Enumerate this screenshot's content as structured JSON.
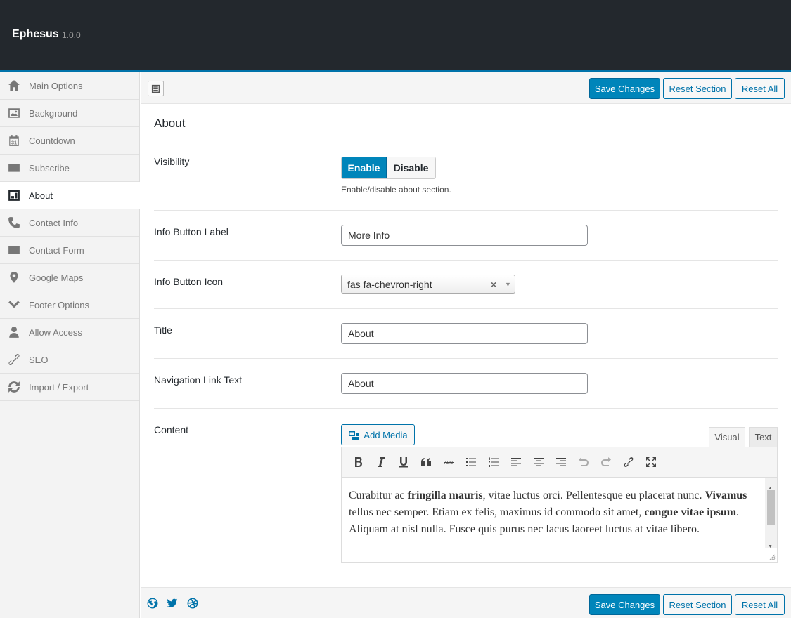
{
  "header": {
    "title": "Ephesus",
    "version": "1.0.0"
  },
  "sidebar": {
    "items": [
      {
        "label": "Main Options",
        "icon": "home-icon"
      },
      {
        "label": "Background",
        "icon": "image-icon"
      },
      {
        "label": "Countdown",
        "icon": "calendar-icon",
        "day": "31"
      },
      {
        "label": "Subscribe",
        "icon": "envelope-icon"
      },
      {
        "label": "About",
        "icon": "window-icon",
        "active": true
      },
      {
        "label": "Contact Info",
        "icon": "phone-icon"
      },
      {
        "label": "Contact Form",
        "icon": "envelope-icon"
      },
      {
        "label": "Google Maps",
        "icon": "map-marker-icon"
      },
      {
        "label": "Footer Options",
        "icon": "chevron-down-icon"
      },
      {
        "label": "Allow Access",
        "icon": "user-icon"
      },
      {
        "label": "SEO",
        "icon": "link-icon"
      },
      {
        "label": "Import / Export",
        "icon": "refresh-icon"
      }
    ]
  },
  "toolbar": {
    "save_label": "Save Changes",
    "reset_section_label": "Reset Section",
    "reset_all_label": "Reset All"
  },
  "section": {
    "title": "About",
    "visibility": {
      "label": "Visibility",
      "enable_label": "Enable",
      "disable_label": "Disable",
      "selected": "Enable",
      "description": "Enable/disable about section."
    },
    "info_button_label": {
      "label": "Info Button Label",
      "value": "More Info"
    },
    "info_button_icon": {
      "label": "Info Button Icon",
      "value": "fas fa-chevron-right",
      "clear": "×",
      "arrow": "▼"
    },
    "title_field": {
      "label": "Title",
      "value": "About"
    },
    "nav_link_text": {
      "label": "Navigation Link Text",
      "value": "About"
    },
    "content": {
      "label": "Content",
      "add_media_label": "Add Media",
      "tab_visual": "Visual",
      "tab_text": "Text",
      "toolbar_buttons": [
        "bold-icon",
        "italic-icon",
        "underline-icon",
        "blockquote-icon",
        "strikethrough-icon",
        "bullet-list-icon",
        "numbered-list-icon",
        "align-left-icon",
        "align-center-icon",
        "align-right-icon",
        "undo-icon",
        "redo-icon",
        "link-icon",
        "fullscreen-icon"
      ],
      "body": {
        "p1_a": "Curabitur ac ",
        "p1_b": "fringilla mauris",
        "p1_c": ", vitae luctus orci. Pellentesque eu placerat nunc. ",
        "p1_d": "Vivamus",
        "p1_e": " tellus nec semper. Etiam ex felis, maximus id commodo sit amet, ",
        "p1_f": "congue vitae ipsum",
        "p1_g": ". Aliquam at nisl nulla. Fusce quis purus nec lacus laoreet luctus at vitae libero."
      }
    }
  },
  "footer": {
    "icons": [
      "globe-icon",
      "twitter-icon",
      "dribbble-icon"
    ],
    "save_label": "Save Changes",
    "reset_section_label": "Reset Section",
    "reset_all_label": "Reset All"
  },
  "colors": {
    "accent": "#0085ba",
    "header_bg": "#23282d",
    "header_border": "#0073aa"
  }
}
